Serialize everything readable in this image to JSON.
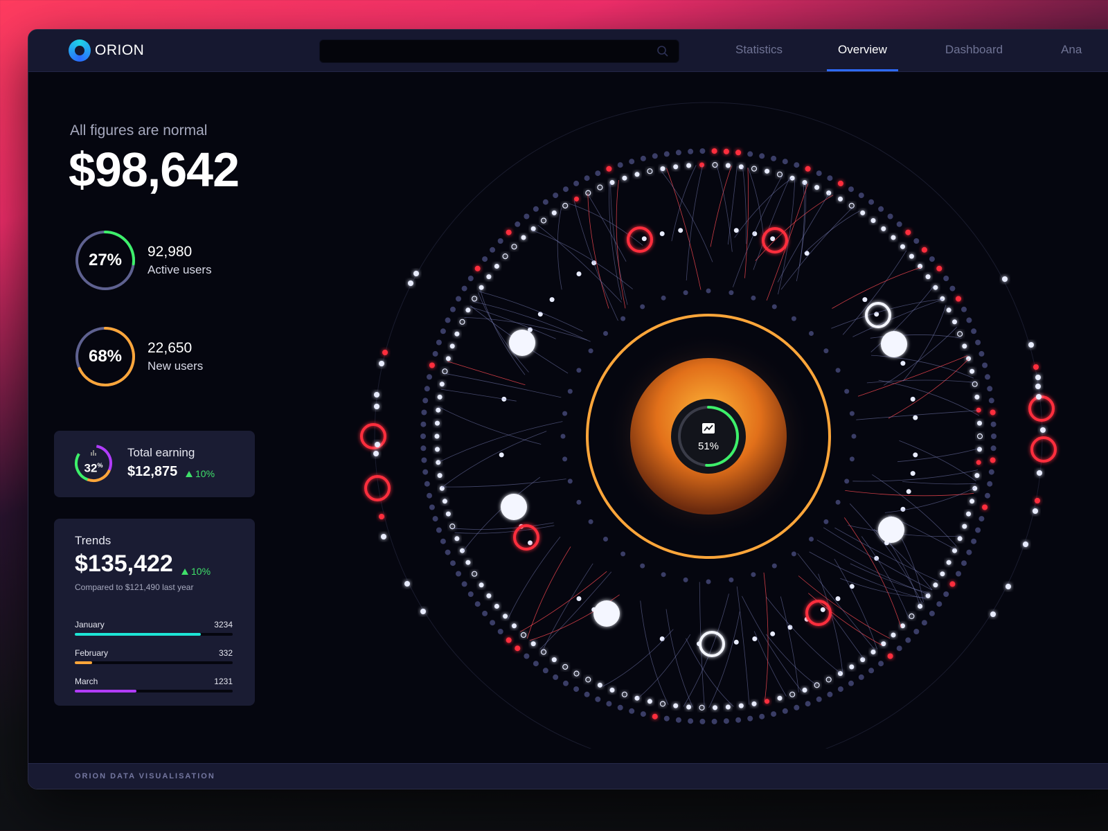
{
  "app": {
    "name": "ORION"
  },
  "search": {
    "placeholder": "",
    "value": ""
  },
  "nav": [
    {
      "label": "Statistics",
      "active": false
    },
    {
      "label": "Overview",
      "active": true
    },
    {
      "label": "Dashboard",
      "active": false
    },
    {
      "label": "Ana",
      "active": false
    }
  ],
  "summary": {
    "status": "All figures are normal",
    "value": "$98,642"
  },
  "kpis": [
    {
      "percent": "27%",
      "fraction": 0.27,
      "value": "92,980",
      "label": "Active users",
      "color": "#3df06a"
    },
    {
      "percent": "68%",
      "fraction": 0.68,
      "value": "22,650",
      "label": "New users",
      "color": "#ffa63a"
    }
  ],
  "earning": {
    "percent": "32",
    "percent_sign": "%",
    "label": "Total earning",
    "value": "$12,875",
    "change": "10%"
  },
  "trends": {
    "title": "Trends",
    "value": "$135,422",
    "change": "10%",
    "note": "Compared to $121,490 last year",
    "months": [
      {
        "label": "January",
        "value": "3234",
        "fraction": 0.8,
        "color": "#1de5d6"
      },
      {
        "label": "February",
        "value": "332",
        "fraction": 0.11,
        "color": "#ffa63a"
      },
      {
        "label": "March",
        "value": "1231",
        "fraction": 0.39,
        "color": "#b13cff"
      }
    ]
  },
  "center": {
    "percent": "51%",
    "fraction": 0.51
  },
  "footer": {
    "text": "ORION DATA VISUALISATION"
  },
  "colors": {
    "accent": "#2e6bff",
    "positive": "#3fe06a",
    "alert": "#ff2d3d",
    "orange": "#ffa63a"
  }
}
